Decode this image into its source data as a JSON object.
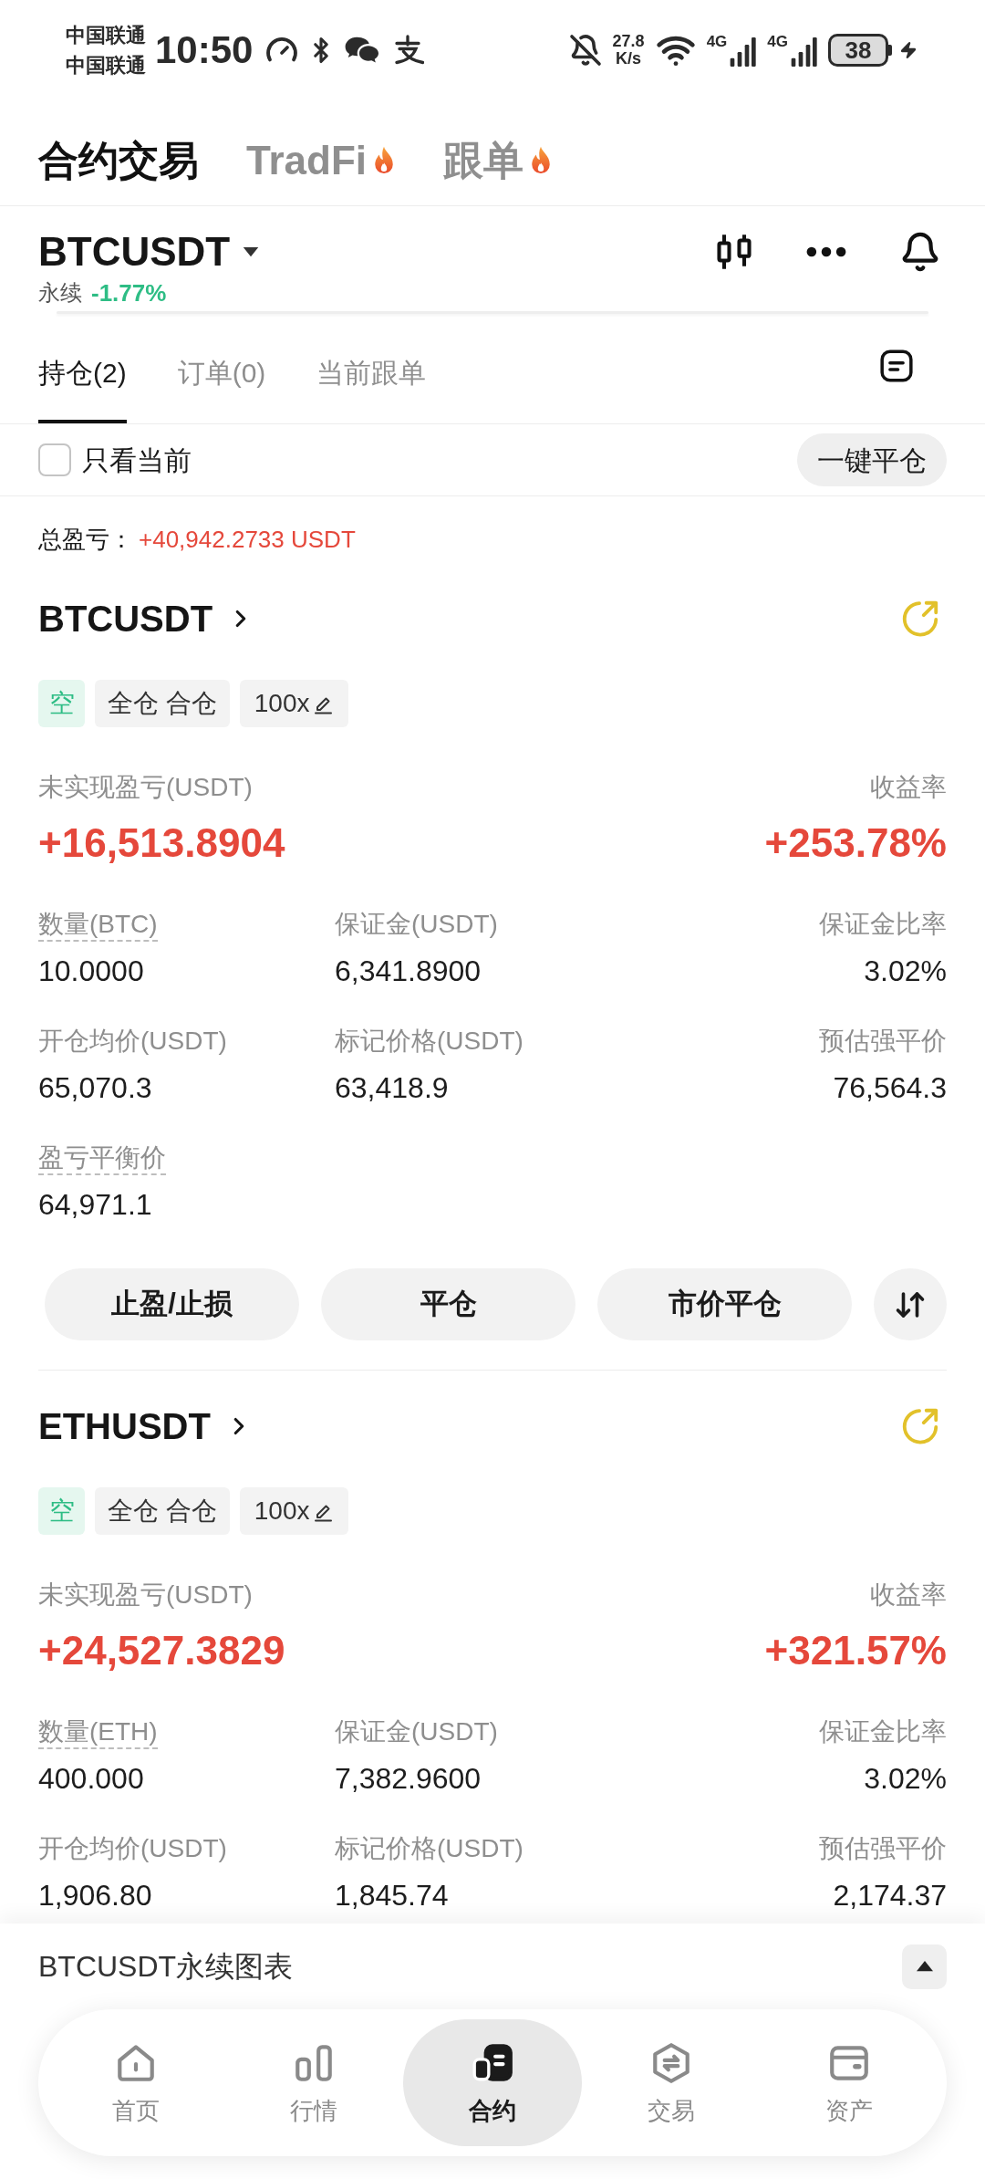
{
  "status_bar": {
    "carriers": [
      "中国联通",
      "中国联通"
    ],
    "time": "10:50",
    "network_speed": "27.8",
    "network_speed_unit": "K/s",
    "mobile_networks": [
      "4G",
      "4G"
    ],
    "battery": "38"
  },
  "top_tabs": [
    {
      "label": "合约交易",
      "selected": true,
      "hot": false
    },
    {
      "label": "TradFi",
      "selected": false,
      "hot": true
    },
    {
      "label": "跟单",
      "selected": false,
      "hot": true
    }
  ],
  "symbol_header": {
    "symbol": "BTCUSDT",
    "contract_type": "永续",
    "change": "-1.77%"
  },
  "position_tabs": [
    {
      "label": "持仓(2)",
      "selected": true
    },
    {
      "label": "订单(0)",
      "selected": false
    },
    {
      "label": "当前跟单",
      "selected": false
    }
  ],
  "filter": {
    "label": "只看当前",
    "checked": false
  },
  "close_all_button": "一键平仓",
  "total_pnl": {
    "label": "总盈亏：",
    "value": "+40,942.2733 USDT"
  },
  "positions": [
    {
      "symbol": "BTCUSDT",
      "side": "空",
      "margin_mode": "全仓 合仓",
      "leverage": "100x",
      "pnl_label": "未实现盈亏(USDT)",
      "roe_label": "收益率",
      "pnl": "+16,513.8904",
      "roe": "+253.78%",
      "fields": [
        {
          "label": "数量(BTC)",
          "value": "10.0000",
          "dashed": true
        },
        {
          "label": "保证金(USDT)",
          "value": "6,341.8900",
          "dashed": false
        },
        {
          "label": "保证金比率",
          "value": "3.02%",
          "dashed": false
        },
        {
          "label": "开仓均价(USDT)",
          "value": "65,070.3",
          "dashed": false
        },
        {
          "label": "标记价格(USDT)",
          "value": "63,418.9",
          "dashed": false
        },
        {
          "label": "预估强平价",
          "value": "76,564.3",
          "dashed": false
        },
        {
          "label": "盈亏平衡价",
          "value": "64,971.1",
          "dashed": true
        }
      ],
      "actions": [
        "止盈/止损",
        "平仓",
        "市价平仓"
      ]
    },
    {
      "symbol": "ETHUSDT",
      "side": "空",
      "margin_mode": "全仓 合仓",
      "leverage": "100x",
      "pnl_label": "未实现盈亏(USDT)",
      "roe_label": "收益率",
      "pnl": "+24,527.3829",
      "roe": "+321.57%",
      "fields": [
        {
          "label": "数量(ETH)",
          "value": "400.000",
          "dashed": true
        },
        {
          "label": "保证金(USDT)",
          "value": "7,382.9600",
          "dashed": false
        },
        {
          "label": "保证金比率",
          "value": "3.02%",
          "dashed": false
        },
        {
          "label": "开仓均价(USDT)",
          "value": "1,906.80",
          "dashed": false
        },
        {
          "label": "标记价格(USDT)",
          "value": "1,845.74",
          "dashed": false
        },
        {
          "label": "预估强平价",
          "value": "2,174.37",
          "dashed": false
        }
      ]
    }
  ],
  "chart_panel": {
    "title": "BTCUSDT永续图表"
  },
  "bottom_nav": [
    {
      "label": "首页",
      "selected": false
    },
    {
      "label": "行情",
      "selected": false
    },
    {
      "label": "合约",
      "selected": true
    },
    {
      "label": "交易",
      "selected": false
    },
    {
      "label": "资产",
      "selected": false
    }
  ]
}
